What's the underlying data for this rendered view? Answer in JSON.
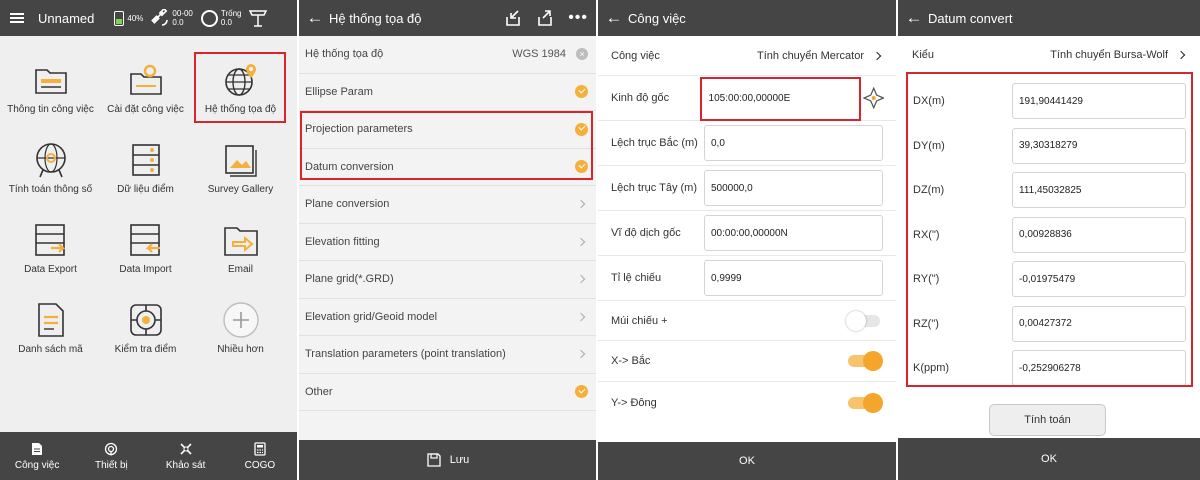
{
  "home": {
    "title": "Unnamed",
    "battery": "40%",
    "gnss": {
      "line1": "00-00",
      "line2": "0.0"
    },
    "status": {
      "line1": "Trống",
      "line2": "0.0"
    },
    "tiles": [
      {
        "label": "Thông tin công việc",
        "icon": "folder-icon"
      },
      {
        "label": "Cài đặt công việc",
        "icon": "folder-settings-icon"
      },
      {
        "label": "Hệ thống tọa độ",
        "icon": "globe-location-icon"
      },
      {
        "label": "Tính toán thông số",
        "icon": "globe-calc-icon"
      },
      {
        "label": "Dữ liệu điểm",
        "icon": "data-list-icon"
      },
      {
        "label": "Survey Gallery",
        "icon": "gallery-icon"
      },
      {
        "label": "Data Export",
        "icon": "export-icon"
      },
      {
        "label": "Data Import",
        "icon": "import-icon"
      },
      {
        "label": "Email",
        "icon": "email-icon"
      },
      {
        "label": "Danh sách mã",
        "icon": "document-icon"
      },
      {
        "label": "Kiểm tra điểm",
        "icon": "target-icon"
      },
      {
        "label": "Nhiều hơn",
        "icon": "plus-icon"
      }
    ],
    "nav": [
      {
        "label": "Công việc",
        "icon": "document-icon"
      },
      {
        "label": "Thiết bị",
        "icon": "device-icon"
      },
      {
        "label": "Khảo sát",
        "icon": "survey-icon"
      },
      {
        "label": "COGO",
        "icon": "calculator-icon"
      }
    ]
  },
  "coord": {
    "title": "Hệ thống tọa độ",
    "rows": [
      {
        "label": "Hệ thống tọa độ",
        "value": "WGS 1984",
        "trail": "clear"
      },
      {
        "label": "Ellipse Param",
        "trail": "check"
      },
      {
        "label": "Projection parameters",
        "trail": "check"
      },
      {
        "label": "Datum conversion",
        "trail": "check"
      },
      {
        "label": "Plane conversion",
        "trail": "chevron"
      },
      {
        "label": "Elevation fitting",
        "trail": "chevron"
      },
      {
        "label": "Plane grid(*.GRD)",
        "trail": "chevron"
      },
      {
        "label": "Elevation grid/Geoid model",
        "trail": "chevron"
      },
      {
        "label": "Translation parameters (point translation)",
        "trail": "chevron"
      },
      {
        "label": "Other",
        "trail": "check"
      }
    ],
    "save_label": "Lưu"
  },
  "job": {
    "title": "Công việc",
    "header_label": "Công việc",
    "header_value": "Tính chuyển Mercator",
    "fields": [
      {
        "label": "Kinh độ gốc",
        "value": "105:00:00,00000E"
      },
      {
        "label": "Lệch trục Bắc (m)",
        "value": "0,0"
      },
      {
        "label": "Lệch trục Tây (m)",
        "value": "500000,0"
      },
      {
        "label": "Vĩ độ dịch gốc",
        "value": "00:00:00,00000N"
      },
      {
        "label": "Tỉ lệ chiếu",
        "value": "0,9999"
      }
    ],
    "toggles": [
      {
        "label": "Múi chiếu +",
        "on": false
      },
      {
        "label": "X-> Bắc",
        "on": true
      },
      {
        "label": "Y-> Đông",
        "on": true
      }
    ],
    "ok_label": "OK"
  },
  "datum": {
    "title": "Datum convert",
    "kind_label": "Kiểu",
    "kind_value": "Tính chuyển Bursa-Wolf",
    "params": [
      {
        "label": "DX(m)",
        "value": "191,90441429"
      },
      {
        "label": "DY(m)",
        "value": "39,30318279"
      },
      {
        "label": "DZ(m)",
        "value": "111,45032825"
      },
      {
        "label": "RX(\")",
        "value": "0,00928836"
      },
      {
        "label": "RY(\")",
        "value": "-0,01975479"
      },
      {
        "label": "RZ(\")",
        "value": "0,00427372"
      },
      {
        "label": "K(ppm)",
        "value": "-0,252906278"
      }
    ],
    "calc_label": "Tính toán",
    "ok_label": "OK"
  },
  "colors": {
    "accent": "#f4a52c",
    "highlight": "#d7262b",
    "bar": "#454545"
  }
}
